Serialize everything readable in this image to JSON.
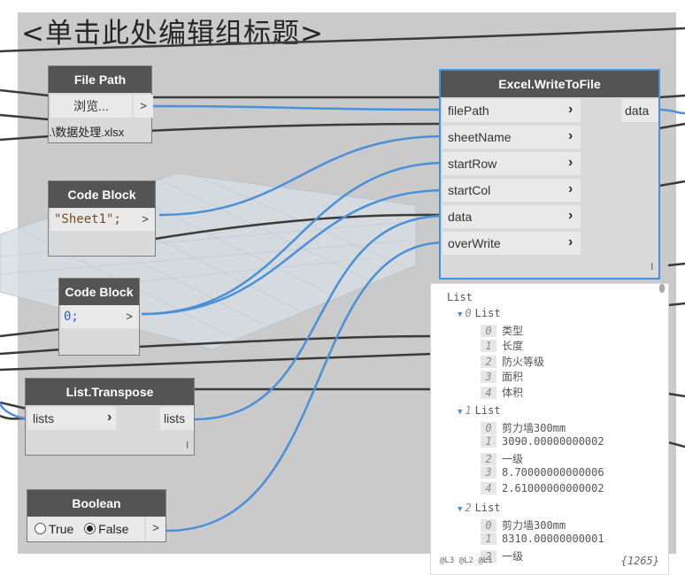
{
  "group": {
    "title": "<单击此处编辑组标题>"
  },
  "file_path_node": {
    "title": "File Path",
    "browse_label": "浏览...",
    "output_arrow": ">",
    "value": ".\\数据处理.xlsx"
  },
  "code_block_1": {
    "title": "Code Block",
    "code": "\"Sheet1\";",
    "output_arrow": ">"
  },
  "code_block_2": {
    "title": "Code Block",
    "code": "0;",
    "output_arrow": ">"
  },
  "list_transpose": {
    "title": "List.Transpose",
    "input": "lists",
    "output": "lists",
    "lacing": "l"
  },
  "boolean_node": {
    "title": "Boolean",
    "true_label": "True",
    "false_label": "False",
    "selected": "False",
    "output_arrow": ">"
  },
  "excel_node": {
    "title": "Excel.WriteToFile",
    "inputs": [
      "filePath",
      "sheetName",
      "startRow",
      "startCol",
      "data",
      "overWrite"
    ],
    "output": "data",
    "lacing": "l"
  },
  "watch": {
    "root": "List",
    "groups": [
      {
        "label": "List",
        "index": "0",
        "items": [
          {
            "i": "0",
            "v": "类型"
          },
          {
            "i": "1",
            "v": "长度"
          },
          {
            "i": "2",
            "v": "防火等级"
          },
          {
            "i": "3",
            "v": "面积"
          },
          {
            "i": "4",
            "v": "体积"
          }
        ]
      },
      {
        "label": "List",
        "index": "1",
        "items": [
          {
            "i": "0",
            "v": "剪力墙300mm"
          },
          {
            "i": "1",
            "v": "3090.00000000002"
          },
          {
            "i": "2",
            "v": "一级"
          },
          {
            "i": "3",
            "v": "8.70000000000006"
          },
          {
            "i": "4",
            "v": "2.61000000000002"
          }
        ]
      },
      {
        "label": "List",
        "index": "2",
        "items": [
          {
            "i": "0",
            "v": "剪力墙300mm"
          },
          {
            "i": "1",
            "v": "8310.00000000001"
          },
          {
            "i": "2",
            "v": "一级"
          }
        ]
      }
    ],
    "footer_levels": "@L3 @L2 @L1",
    "count": "{1265}"
  },
  "colors": {
    "group_bg": "#cacaca",
    "node_header": "#545454",
    "wire_active": "#4a90d9",
    "wire_dark": "#3a3a3a",
    "selection": "#4a90d9"
  }
}
